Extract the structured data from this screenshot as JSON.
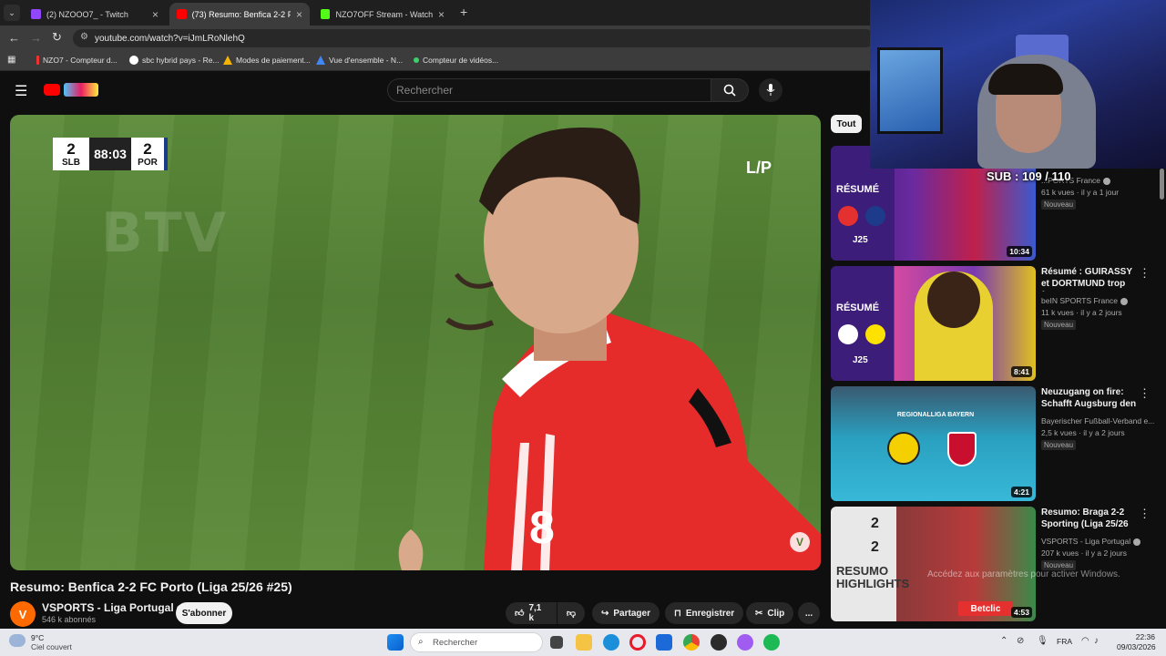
{
  "browser": {
    "tabs": [
      {
        "label": "(2) NZOOO7_ - Twitch",
        "active": false
      },
      {
        "label": "(73) Resumo: Benfica 2-2 FC Po",
        "active": true
      },
      {
        "label": "NZO7OFF Stream - Watch Live",
        "active": false
      }
    ],
    "url": "youtube.com/watch?v=iJmLRoNlehQ",
    "bookmarks": [
      "NZO7 - Compteur d...",
      "sbc hybrid pays - Re...",
      "Modes de paiement...",
      "Vue d'ensemble - N...",
      "Compteur de vidéos..."
    ]
  },
  "youtube": {
    "search_placeholder": "Rechercher",
    "video": {
      "scoreboard": {
        "home_score": "2",
        "home": "SLB",
        "clock": "88:03",
        "away_score": "2",
        "away": "POR"
      },
      "title": "Resumo: Benfica 2-2 FC Porto (Liga 25/26 #25)",
      "channel": "VSPORTS - Liga Portugal",
      "channel_avatar": "V",
      "subscribers": "546 k abonnés",
      "subscribe_label": "S'abonner",
      "likes": "7,1 k",
      "share_label": "Partager",
      "save_label": "Enregistrer",
      "clip_label": "Clip",
      "more_label": "..."
    },
    "filter_chip": "Tout",
    "recommendations": [
      {
        "title": "",
        "channel": "...PORTS France",
        "meta": "61 k vues · il y a 1 jour",
        "badge": "Nouveau",
        "duration": "10:34",
        "thumb_text": "RÉSUMÉ",
        "thumb_sub": "J25"
      },
      {
        "title": "Résumé : GUIRASSY et DORTMUND trop forts...",
        "channel": "beIN SPORTS France",
        "meta": "11 k vues · il y a 2 jours",
        "badge": "Nouveau",
        "duration": "8:41",
        "thumb_text": "RÉSUMÉ",
        "thumb_sub": "J25"
      },
      {
        "title": "Neuzugang on fire: Schafft Augsburg den ...",
        "channel": "Bayerischer Fußball-Verband e...",
        "meta": "2,5 k vues · il y a 2 jours",
        "badge": "Nouveau",
        "duration": "4:21",
        "thumb_text": "REGIONALLIGA BAYERN",
        "thumb_sub": ""
      },
      {
        "title": "Resumo: Braga 2-2 Sporting (Liga 25/26 ...",
        "channel": "VSPORTS - Liga Portugal",
        "meta": "207 k vues · il y a 2 jours",
        "badge": "Nouveau",
        "duration": "4:53",
        "thumb_text": "RESUMO HIGHLIGHTS",
        "thumb_sub": "2"
      }
    ]
  },
  "overlay": {
    "sub_counter": "SUB : 109 / 110",
    "windows_watermark": "Accédez aux paramètres pour activer Windows."
  },
  "taskbar": {
    "weather_temp": "9°C",
    "weather_desc": "Ciel couvert",
    "search_placeholder": "Rechercher",
    "language": "FRA",
    "time": "22:36",
    "date": "09/03/2026"
  },
  "colors": {
    "yt_red": "#ff0000",
    "benfica_red": "#e53030",
    "page_bg": "#0f0f0f"
  }
}
